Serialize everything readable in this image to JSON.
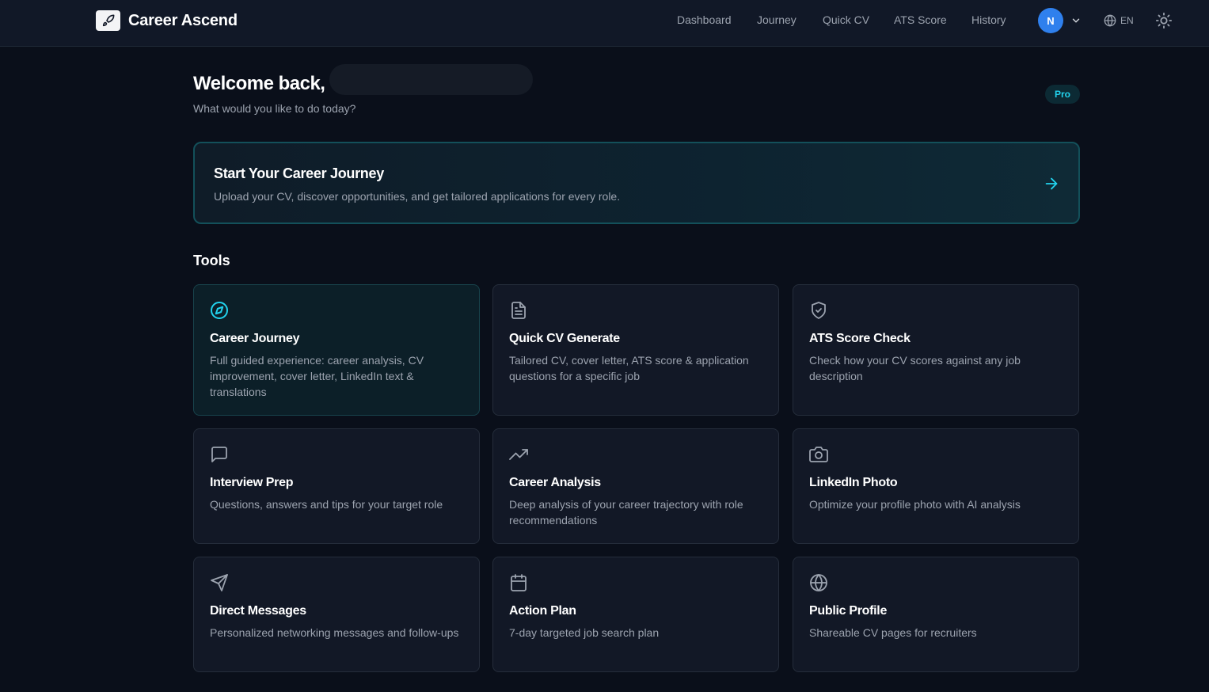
{
  "header": {
    "brand": "Career Ascend",
    "nav": [
      "Dashboard",
      "Journey",
      "Quick CV",
      "ATS Score",
      "History"
    ],
    "avatar_initial": "N",
    "language": "EN"
  },
  "welcome": {
    "title": "Welcome back,",
    "subtitle": "What would you like to do today?",
    "plan_badge": "Pro"
  },
  "hero": {
    "title": "Start Your Career Journey",
    "subtitle": "Upload your CV, discover opportunities, and get tailored applications for every role."
  },
  "tools": {
    "section_title": "Tools",
    "items": [
      {
        "icon": "compass-icon",
        "title": "Career Journey",
        "desc": "Full guided experience: career analysis, CV improvement, cover letter, LinkedIn text & translations"
      },
      {
        "icon": "document-icon",
        "title": "Quick CV Generate",
        "desc": "Tailored CV, cover letter, ATS score & application questions for a specific job"
      },
      {
        "icon": "shield-check-icon",
        "title": "ATS Score Check",
        "desc": "Check how your CV scores against any job description"
      },
      {
        "icon": "message-square-icon",
        "title": "Interview Prep",
        "desc": "Questions, answers and tips for your target role"
      },
      {
        "icon": "trending-up-icon",
        "title": "Career Analysis",
        "desc": "Deep analysis of your career trajectory with role recommendations"
      },
      {
        "icon": "camera-icon",
        "title": "LinkedIn Photo",
        "desc": "Optimize your profile photo with AI analysis"
      },
      {
        "icon": "send-icon",
        "title": "Direct Messages",
        "desc": "Personalized networking messages and follow-ups"
      },
      {
        "icon": "calendar-icon",
        "title": "Action Plan",
        "desc": "7-day targeted job search plan"
      },
      {
        "icon": "globe-icon",
        "title": "Public Profile",
        "desc": "Shareable CV pages for recruiters"
      }
    ]
  },
  "colors": {
    "background": "#0a0f1a",
    "header": "#111827",
    "accent": "#22d3ee",
    "avatar": "#2f80ed"
  }
}
